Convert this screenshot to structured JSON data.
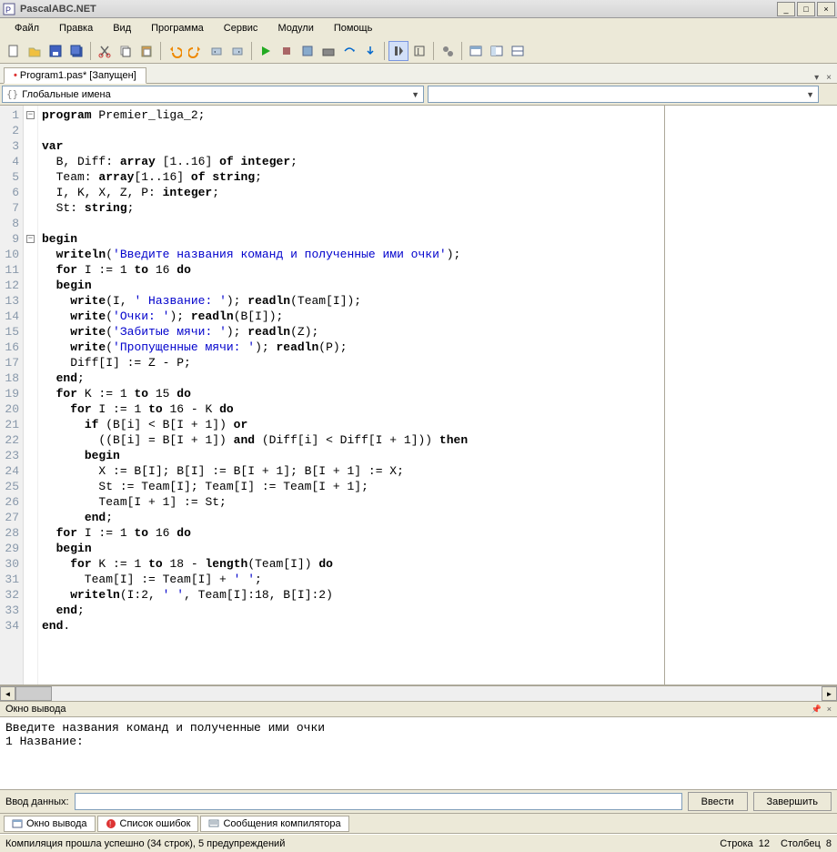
{
  "window": {
    "title": "PascalABC.NET"
  },
  "menu": [
    "Файл",
    "Правка",
    "Вид",
    "Программа",
    "Сервис",
    "Модули",
    "Помощь"
  ],
  "tab": {
    "label": "Program1.pas* [Запущен]"
  },
  "namespace": {
    "label": "Глобальные имена"
  },
  "code_lines": [
    "program Premier_liga_2;",
    "",
    "var",
    "  B, Diff: array [1..16] of integer;",
    "  Team: array[1..16] of string;",
    "  I, K, X, Z, P: integer;",
    "  St: string;",
    "",
    "begin",
    "  writeln('Введите названия команд и полученные ими очки');",
    "  for I := 1 to 16 do",
    "  begin",
    "    write(I, ' Название: '); readln(Team[I]);",
    "    write('Очки: '); readln(B[I]);",
    "    write('Забитые мячи: '); readln(Z);",
    "    write('Пропущенные мячи: '); readln(P);",
    "    Diff[I] := Z - P;",
    "  end;",
    "  for K := 1 to 15 do",
    "    for I := 1 to 16 - K do",
    "      if (B[i] < B[I + 1]) or",
    "        ((B[i] = B[I + 1]) and (Diff[i] < Diff[I + 1])) then",
    "      begin",
    "        X := B[I]; B[I] := B[I + 1]; B[I + 1] := X;",
    "        St := Team[I]; Team[I] := Team[I + 1];",
    "        Team[I + 1] := St;",
    "      end;",
    "  for I := 1 to 16 do",
    "  begin",
    "    for K := 1 to 18 - length(Team[I]) do",
    "      Team[I] := Team[I] + ' ';",
    "    writeln(I:2, ' ', Team[I]:18, B[I]:2)",
    "  end;",
    "end."
  ],
  "line_count": 34,
  "output_panel": {
    "title": "Окно вывода"
  },
  "output_text": "Введите названия команд и полученные ими очки\n1 Название:",
  "input": {
    "label": "Ввод данных:",
    "enter_btn": "Ввести",
    "finish_btn": "Завершить"
  },
  "bottom_tabs": [
    {
      "label": "Окно вывода",
      "icon": "output-icon"
    },
    {
      "label": "Список ошибок",
      "icon": "error-icon"
    },
    {
      "label": "Сообщения компилятора",
      "icon": "messages-icon"
    }
  ],
  "status": {
    "left": "Компиляция прошла успешно (34 строк), 5 предупреждений",
    "line_lbl": "Строка",
    "line_val": "12",
    "col_lbl": "Столбец",
    "col_val": "8"
  }
}
